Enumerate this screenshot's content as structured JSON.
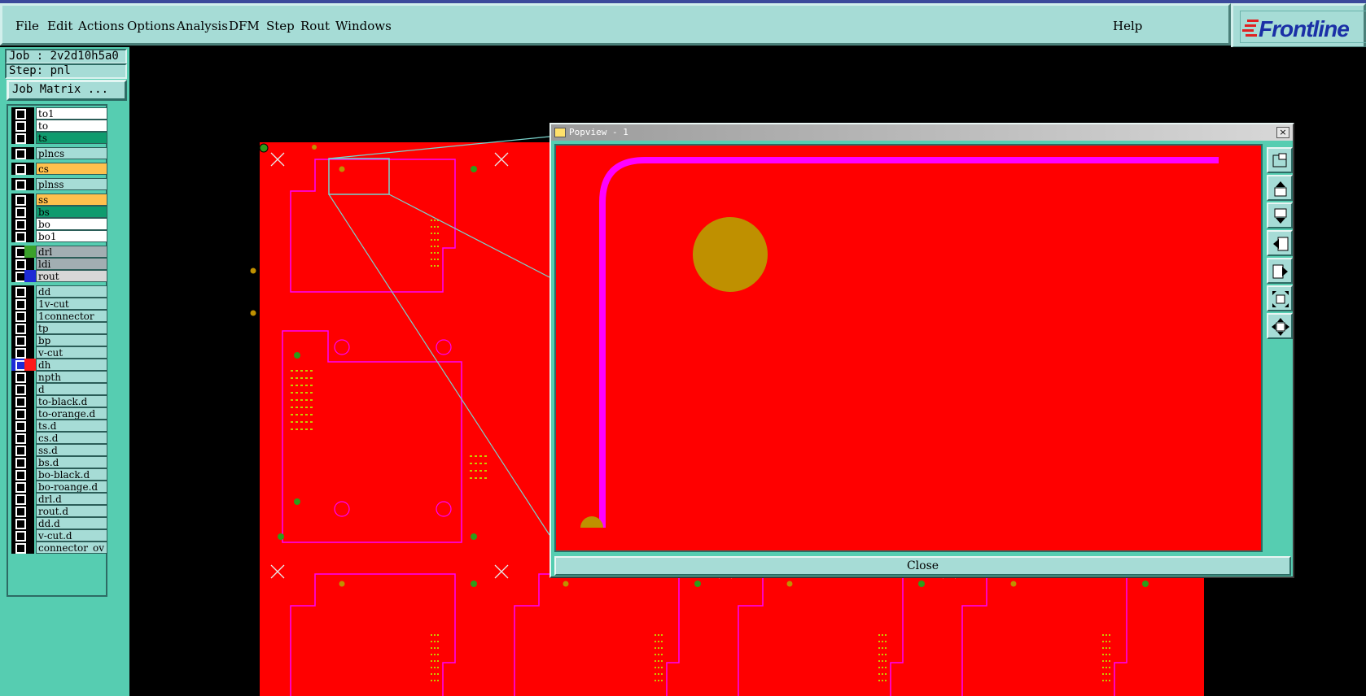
{
  "menubar": {
    "items": [
      "File",
      "Edit",
      "Actions",
      "Options",
      "Analysis",
      "DFM",
      "Step",
      "Rout",
      "Windows"
    ],
    "help": "Help"
  },
  "logo": {
    "text": "Frontline"
  },
  "leftpanel": {
    "job": "Job : 2v2d10h5a0",
    "step": "Step: pnl",
    "job_matrix": "Job Matrix ..."
  },
  "layers": [
    {
      "name": "to1",
      "color": "#ffffff"
    },
    {
      "name": "to",
      "color": "#ffffff"
    },
    {
      "name": "ts",
      "color": "#0f9b6e"
    },
    {
      "name": "plncs",
      "color": "#a6dcd6"
    },
    {
      "name": "cs",
      "color": "#ffc04d"
    },
    {
      "name": "plnss",
      "color": "#a6dcd6"
    },
    {
      "name": "ss",
      "color": "#ffc04d"
    },
    {
      "name": "bs",
      "color": "#0f9b6e"
    },
    {
      "name": "bo",
      "color": "#ffffff"
    },
    {
      "name": "bo1",
      "color": "#ffffff"
    },
    {
      "name": "drl",
      "color": "#a2aeb2",
      "swatch": "#3aa12a"
    },
    {
      "name": "ldi",
      "color": "#a2aeb2"
    },
    {
      "name": "rout",
      "color": "#d7d7d7",
      "swatch": "#1d2bd6"
    },
    {
      "name": "dd",
      "color": "#a6dcd6"
    },
    {
      "name": "1v-cut",
      "color": "#a6dcd6"
    },
    {
      "name": "1connector_",
      "color": "#a6dcd6"
    },
    {
      "name": "tp",
      "color": "#a6dcd6"
    },
    {
      "name": "bp",
      "color": "#a6dcd6"
    },
    {
      "name": "v-cut",
      "color": "#a6dcd6"
    },
    {
      "name": "dh",
      "color": "#a6dcd6",
      "swatch": "#ff1a1a",
      "check": "#1d2bd6"
    },
    {
      "name": "npth",
      "color": "#a6dcd6"
    },
    {
      "name": "d",
      "color": "#a6dcd6"
    },
    {
      "name": "to-black.d",
      "color": "#a6dcd6"
    },
    {
      "name": "to-orange.d",
      "color": "#a6dcd6"
    },
    {
      "name": "ts.d",
      "color": "#a6dcd6"
    },
    {
      "name": "cs.d",
      "color": "#a6dcd6"
    },
    {
      "name": "ss.d",
      "color": "#a6dcd6"
    },
    {
      "name": "bs.d",
      "color": "#a6dcd6"
    },
    {
      "name": "bo-black.d",
      "color": "#a6dcd6"
    },
    {
      "name": "bo-roange.d",
      "color": "#a6dcd6"
    },
    {
      "name": "drl.d",
      "color": "#a6dcd6"
    },
    {
      "name": "rout.d",
      "color": "#a6dcd6"
    },
    {
      "name": "dd.d",
      "color": "#a6dcd6"
    },
    {
      "name": "v-cut.d",
      "color": "#a6dcd6"
    },
    {
      "name": "connector_ov",
      "color": "#a6dcd6"
    }
  ],
  "popview": {
    "title": "Popview - 1",
    "close_x": "×",
    "close_label": "Close",
    "tools": [
      "zoom-window-icon",
      "pan-up-icon",
      "pan-down-icon",
      "pan-left-icon",
      "pan-right-icon",
      "zoom-fit-icon",
      "center-icon"
    ]
  },
  "colors": {
    "board": "#ff0000",
    "profile": "#ff00ff",
    "pad": "#bf9000",
    "via": "#2e9c1a",
    "leader": "#79d3cc"
  }
}
